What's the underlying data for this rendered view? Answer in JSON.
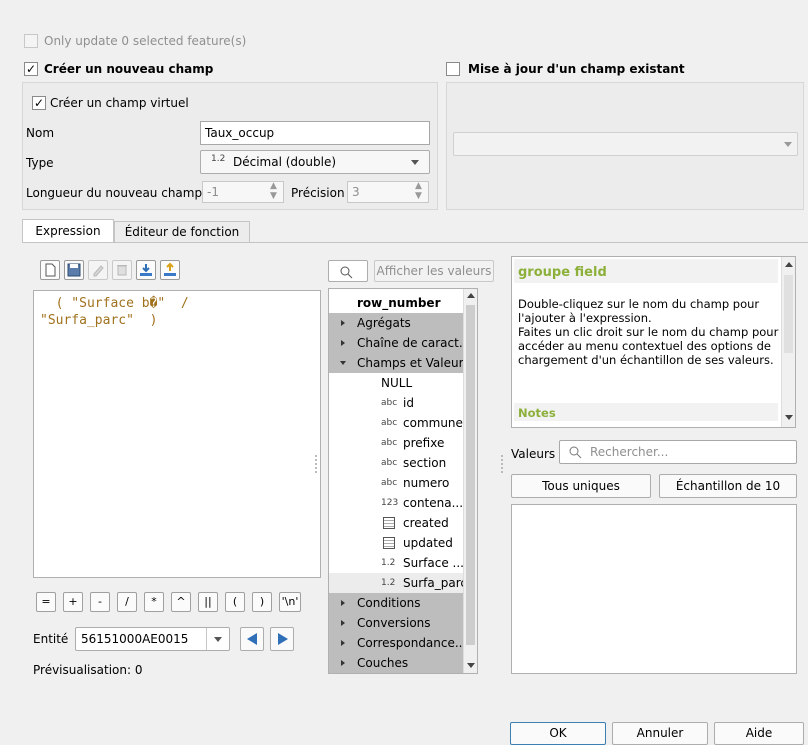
{
  "top": {
    "only_update": "Only update 0 selected feature(s)",
    "create_new_field": "Créer un nouveau champ",
    "update_existing": "Mise à jour d'un champ existant"
  },
  "new_field": {
    "virtual": "Créer un champ virtuel",
    "name_label": "Nom",
    "name_value": "Taux_occup",
    "type_label": "Type",
    "type_badge": "1.2",
    "type_value": "Décimal (double)",
    "length_label": "Longueur du nouveau champ",
    "length_value": "-1",
    "precision_label": "Précision",
    "precision_value": "3"
  },
  "tabs": {
    "expression": "Expression",
    "function_editor": "Éditeur de fonction"
  },
  "expression": {
    "line1": "  ( \"Surface b\u0000\"  /",
    "line2": "\"Surfa_parc\"  )"
  },
  "operators": [
    "=",
    "+",
    "-",
    "/",
    "*",
    "^",
    "||",
    "(",
    ")",
    "'\\n'"
  ],
  "entity": {
    "label": "Entité",
    "value": "56151000AE0015"
  },
  "preview": "Prévisualisation:  0",
  "search": {
    "show_values": "Afficher les valeurs"
  },
  "tree": {
    "items": [
      {
        "label": "row_number"
      },
      {
        "label": "Agrégats"
      },
      {
        "label": "Chaîne de caract..."
      },
      {
        "label": "Champs et Valeurs"
      },
      {
        "label": "NULL"
      },
      {
        "label": "id",
        "type": "abc"
      },
      {
        "label": "commune",
        "type": "abc"
      },
      {
        "label": "prefixe",
        "type": "abc"
      },
      {
        "label": "section",
        "type": "abc"
      },
      {
        "label": "numero",
        "type": "abc"
      },
      {
        "label": "contena...",
        "type": "123"
      },
      {
        "label": "created"
      },
      {
        "label": "updated"
      },
      {
        "label": "Surface ...",
        "type": "1.2"
      },
      {
        "label": "Surfa_parc",
        "type": "1.2"
      },
      {
        "label": "Conditions"
      },
      {
        "label": "Conversions"
      },
      {
        "label": "Correspondance..."
      },
      {
        "label": "Couches"
      }
    ]
  },
  "help": {
    "title": "groupe field",
    "body": "Double-cliquez sur le nom du champ pour l'ajouter à l'expression.\nFaites un clic droit sur le nom du champ pour accéder au menu contextuel des options de chargement d'un échantillon de ses valeurs.",
    "notes": "Notes"
  },
  "values": {
    "label": "Valeurs",
    "search_placeholder": "Rechercher...",
    "all_unique": "Tous uniques",
    "sample": "Échantillon de 10"
  },
  "buttons": {
    "ok": "OK",
    "cancel": "Annuler",
    "help": "Aide"
  },
  "colors": {
    "help_title": "#8cb03a",
    "tree_selected": "#bdbdbd",
    "play_blue": "#2f6fb8"
  }
}
